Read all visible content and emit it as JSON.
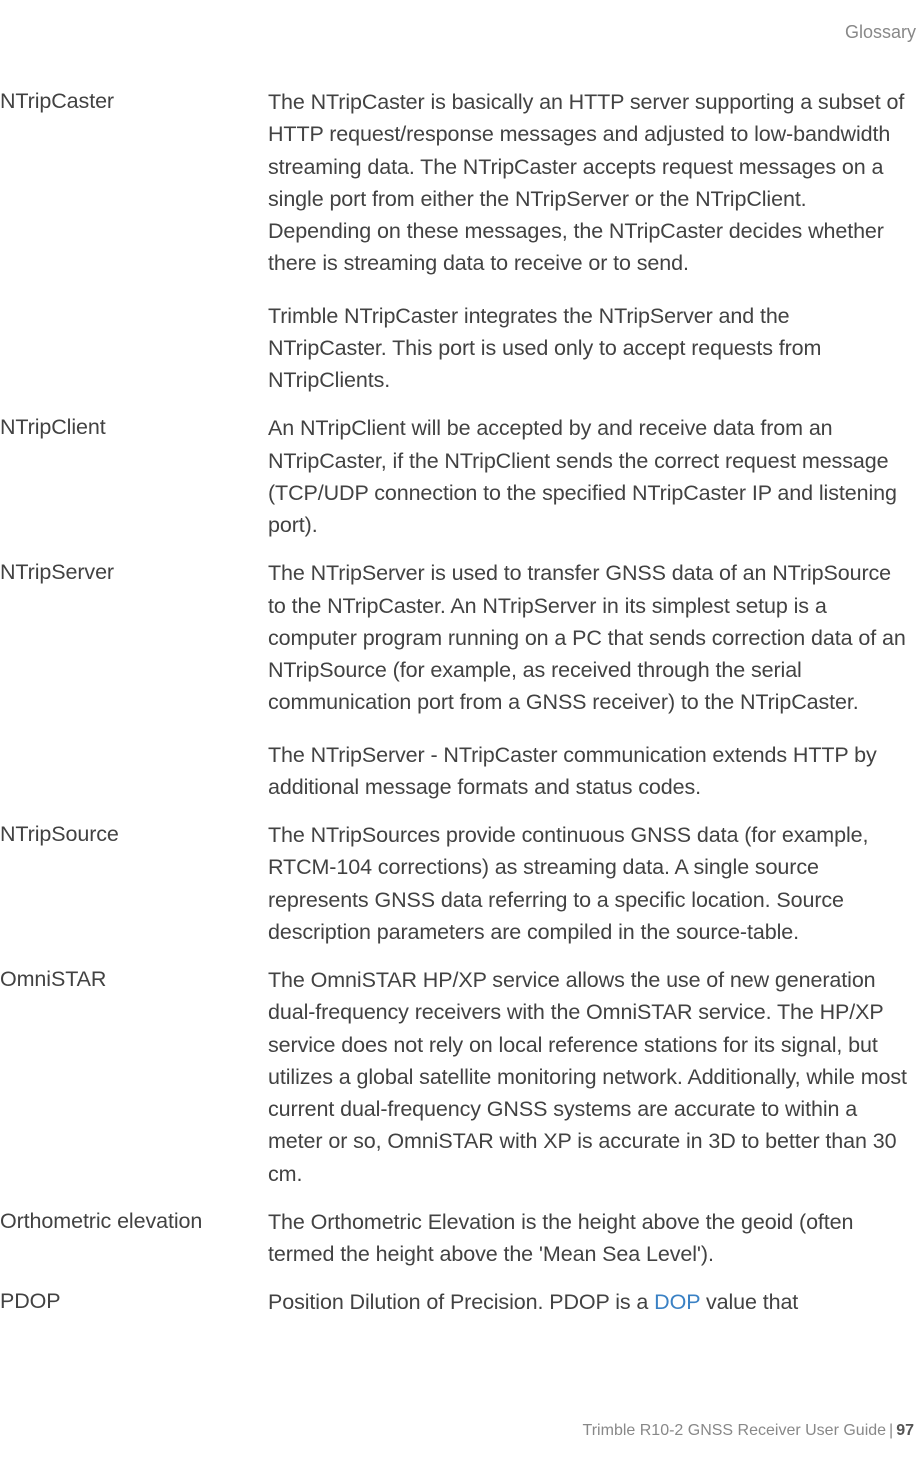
{
  "header": {
    "section": "Glossary"
  },
  "entries": [
    {
      "term": "NTripCaster",
      "defs": [
        "The NTripCaster is basically an HTTP server supporting a subset of HTTP request/response messages and adjusted to low-bandwidth streaming data. The NTripCaster accepts request messages on a single port from either the NTripServer or the NTripClient. Depending on these messages, the NTripCaster decides whether there is streaming data to receive or to send.",
        "Trimble NTripCaster integrates the NTripServer and the NTripCaster. This port is used only to accept requests from NTripClients."
      ]
    },
    {
      "term": "NTripClient",
      "defs": [
        "An NTripClient will be accepted by and receive data from an NTripCaster, if the NTripClient sends the correct request message (TCP/UDP connection to the specified NTripCaster IP and listening port)."
      ]
    },
    {
      "term": "NTripServer",
      "defs": [
        "The NTripServer is used to transfer GNSS data of an NTripSource to the NTripCaster. An NTripServer in its simplest setup is a computer program running on a PC that sends correction data of an NTripSource (for example, as received through the serial communication port from a GNSS receiver) to the NTripCaster.",
        "The NTripServer - NTripCaster communication extends HTTP by additional message formats and status codes."
      ]
    },
    {
      "term": "NTripSource",
      "defs": [
        "The NTripSources provide continuous GNSS data (for example, RTCM-104 corrections) as streaming data. A single source represents GNSS data referring to a specific location. Source description parameters are compiled in the source-table."
      ]
    },
    {
      "term": "OmniSTAR",
      "defs": [
        "The OmniSTAR HP/XP service allows the use of new generation dual-frequency receivers with the OmniSTAR service. The HP/XP service does not rely on local reference stations for its signal, but utilizes a global satellite monitoring network. Additionally, while most current dual-frequency GNSS systems are accurate to within a meter or so, OmniSTAR with XP is accurate in 3D to better than 30 cm."
      ]
    },
    {
      "term": "Orthometric elevation",
      "defs": [
        "The Orthometric Elevation is the height above the geoid (often termed the height above the 'Mean Sea Level')."
      ]
    },
    {
      "term": "PDOP",
      "defs": [
        {
          "pre": "Position Dilution of Precision. PDOP is a ",
          "link": "DOP",
          "post": " value that"
        }
      ]
    }
  ],
  "footer": {
    "doc": "Trimble R10-2 GNSS Receiver User Guide",
    "page": "97"
  }
}
